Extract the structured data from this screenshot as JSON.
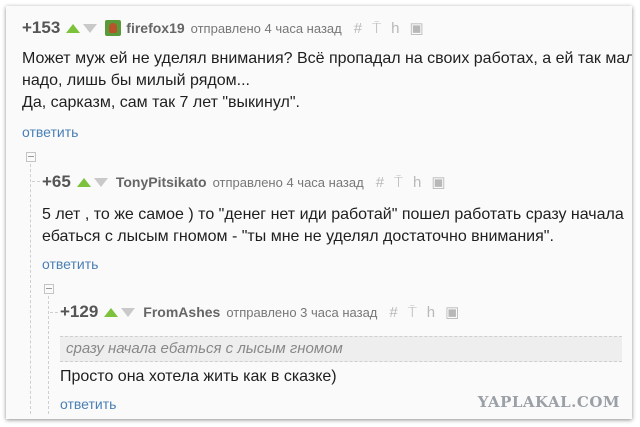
{
  "comments": [
    {
      "rating": "+153",
      "author": "firefox19",
      "meta": "отправлено 4 часа назад",
      "text_lines": [
        "Может муж ей не уделял внимания? Всё пропадал на своих работах, а ей так мало",
        "надо, лишь бы милый рядом...",
        "Да, сарказм, сам так 7 лет \"выкинул\"."
      ],
      "reply_label": "ответить"
    },
    {
      "rating": "+65",
      "author": "TonyPitsikato",
      "meta": "отправлено 4 часа назад",
      "text_lines": [
        "5 лет , то же самое ) то \"денег нет иди работай\" пошел работать сразу начала",
        "ебаться с лысым гномом - \"ты мне не уделял достаточно внимания\"."
      ],
      "reply_label": "ответить"
    },
    {
      "rating": "+129",
      "author": "FromAshes",
      "meta": "отправлено 3 часа назад",
      "quote": "сразу начала ебаться с лысым гномом",
      "text_lines": [
        "Просто она хотела жить как в сказке)"
      ],
      "reply_label": "ответить"
    }
  ],
  "action_icons": [
    "hash-icon",
    "pin-icon",
    "branch-icon",
    "save-icon"
  ],
  "icon_glyphs": {
    "hash": "#",
    "pin": "⍑",
    "branch": "h",
    "save": "▣"
  },
  "watermark": "YAPLAKAL.COM",
  "colors": {
    "upvote": "#7cc23a",
    "downvote": "#c9c9c9",
    "reply_link": "#4a7fb5",
    "quote_bg": "#eeeeee"
  }
}
